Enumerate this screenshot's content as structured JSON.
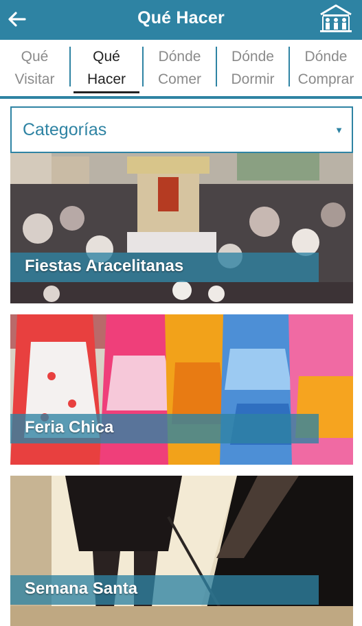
{
  "header": {
    "title": "Qué Hacer",
    "accent_color": "#2e83a3",
    "back_icon": "arrow-left-icon",
    "logo_icon": "town-hall-logo-icon"
  },
  "tabs": [
    {
      "line1": "Qué",
      "line2": "Visitar",
      "active": false
    },
    {
      "line1": "Qué",
      "line2": "Hacer",
      "active": true
    },
    {
      "line1": "Dónde",
      "line2": "Comer",
      "active": false
    },
    {
      "line1": "Dónde",
      "line2": "Dormir",
      "active": false
    },
    {
      "line1": "Dónde",
      "line2": "Comprar",
      "active": false
    }
  ],
  "filter": {
    "label": "Categorías",
    "arrow_icon": "dropdown-triangle-icon"
  },
  "cards": [
    {
      "title": "Fiestas Aracelitanas"
    },
    {
      "title": "Feria Chica"
    },
    {
      "title": "Semana Santa"
    }
  ]
}
